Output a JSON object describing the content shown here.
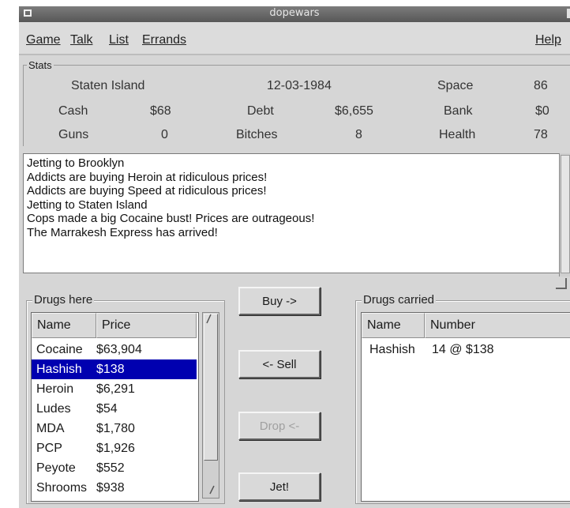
{
  "window": {
    "title": "dopewars"
  },
  "menu": {
    "items": [
      {
        "label": "Game",
        "key": "game"
      },
      {
        "label": "Talk",
        "key": "talk"
      },
      {
        "label": "List",
        "key": "list"
      },
      {
        "label": "Errands",
        "key": "errands"
      }
    ],
    "help": "Help"
  },
  "stats": {
    "legend": "Stats",
    "location": "Staten Island",
    "date": "12-03-1984",
    "space_label": "Space",
    "space_value": "86",
    "cash_label": "Cash",
    "cash_value": "$68",
    "debt_label": "Debt",
    "debt_value": "$6,655",
    "bank_label": "Bank",
    "bank_value": "$0",
    "guns_label": "Guns",
    "guns_value": "0",
    "bitches_label": "Bitches",
    "bitches_value": "8",
    "health_label": "Health",
    "health_value": "78"
  },
  "messages": [
    "Jetting to Brooklyn",
    "Addicts are buying Heroin at ridiculous prices!",
    "Addicts are buying Speed at ridiculous prices!",
    "Jetting to Staten Island",
    "Cops made a big Cocaine bust! Prices are outrageous!",
    "The Marrakesh Express has arrived!"
  ],
  "drugs_here": {
    "legend": "Drugs here",
    "col_name": "Name",
    "col_price": "Price",
    "rows": [
      {
        "name": "Cocaine",
        "price": "$63,904"
      },
      {
        "name": "Hashish",
        "price": "$138"
      },
      {
        "name": "Heroin",
        "price": "$6,291"
      },
      {
        "name": "Ludes",
        "price": "$54"
      },
      {
        "name": "MDA",
        "price": "$1,780"
      },
      {
        "name": "PCP",
        "price": "$1,926"
      },
      {
        "name": "Peyote",
        "price": "$552"
      },
      {
        "name": "Shrooms",
        "price": "$938"
      }
    ],
    "selected_name": "Hashish"
  },
  "buttons": {
    "buy": "Buy ->",
    "sell": "<- Sell",
    "drop": "Drop <-",
    "jet": "Jet!"
  },
  "drugs_carried": {
    "legend": "Drugs carried",
    "col_name": "Name",
    "col_number": "Number",
    "rows": [
      {
        "name": "Hashish",
        "number": "14 @ $138"
      }
    ]
  }
}
